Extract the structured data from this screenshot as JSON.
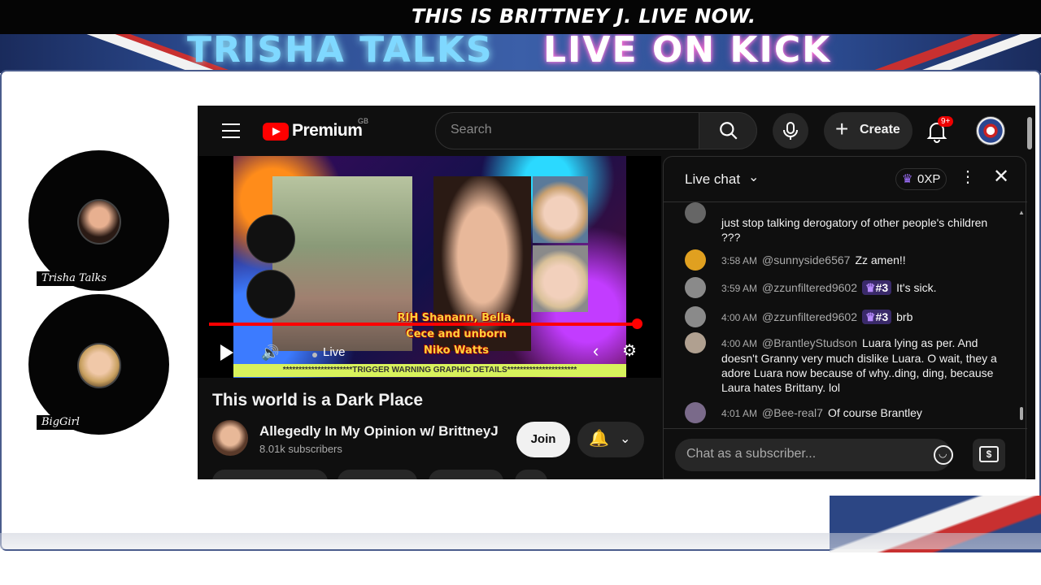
{
  "overlay": {
    "ticker_text": "THIS IS BRITTNEY J. LIVE NOW.",
    "banner_left": "TRISHA TALKS",
    "banner_right": "LIVE ON KICK",
    "cams": [
      {
        "name": "Trisha Talks"
      },
      {
        "name": "BigGirl"
      }
    ]
  },
  "youtube": {
    "logo_text": "Premium",
    "country_code": "GB",
    "search_placeholder": "Search",
    "create_label": "Create",
    "notification_badge": "9+",
    "video": {
      "caption_lines": [
        "RIH Shanann, Bella,",
        "Cece and unborn",
        "Niko Watts"
      ],
      "warning_text": "**********************TRIGGER WARNING GRAPHIC DETAILS**********************",
      "live_label": "Live",
      "progress": 1.0
    },
    "video_title": "This world is a Dark Place",
    "channel": {
      "name": "Allegedly In My Opinion w/ BrittneyJ",
      "subscribers": "8.01k subscribers",
      "join_label": "Join"
    }
  },
  "chat": {
    "title": "Live chat",
    "xp": "0XP",
    "input_placeholder": "Chat as a subscriber...",
    "messages": [
      {
        "time": "",
        "user": "",
        "rank": "",
        "text": "just stop talking derogatory of other people's children ???",
        "avatar_color": "#666666"
      },
      {
        "time": "3:58 AM",
        "user": "@sunnyside6567",
        "rank": "",
        "text": "Zz amen!!",
        "avatar_color": "#e0a020"
      },
      {
        "time": "3:59 AM",
        "user": "@zzunfiltered9602",
        "rank": "#3",
        "text": "It's sick.",
        "avatar_color": "#8a8a8a"
      },
      {
        "time": "4:00 AM",
        "user": "@zzunfiltered9602",
        "rank": "#3",
        "text": "brb",
        "avatar_color": "#8a8a8a"
      },
      {
        "time": "4:00 AM",
        "user": "@BrantleyStudson",
        "rank": "",
        "text": "Luara lying as per. And doesn't Granny very much dislike Luara. O wait, they a adore Luara now because of why..ding, ding, because Laura hates Brittany. lol",
        "avatar_color": "#b0a090"
      },
      {
        "time": "4:01 AM",
        "user": "@Bee-real7",
        "rank": "",
        "text": "Of course Brantley",
        "avatar_color": "#7a6a8a"
      }
    ]
  }
}
